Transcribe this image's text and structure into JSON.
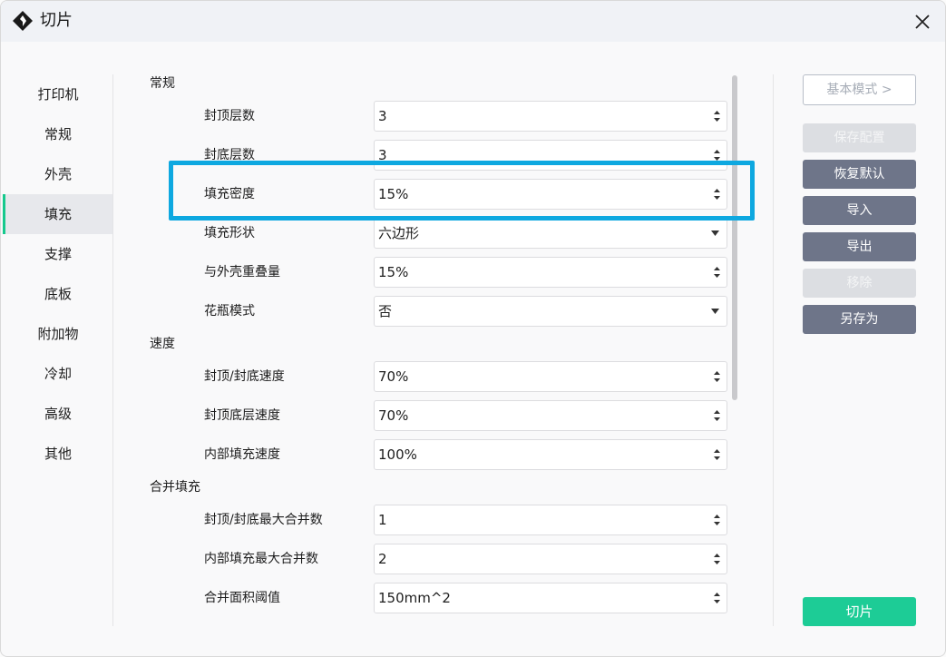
{
  "window": {
    "title": "切片"
  },
  "sidebar": {
    "items": [
      {
        "label": "打印机"
      },
      {
        "label": "常规"
      },
      {
        "label": "外壳"
      },
      {
        "label": "填充"
      },
      {
        "label": "支撑"
      },
      {
        "label": "底板"
      },
      {
        "label": "附加物"
      },
      {
        "label": "冷却"
      },
      {
        "label": "高级"
      },
      {
        "label": "其他"
      }
    ],
    "active_index": 3
  },
  "sections": {
    "general": {
      "title": "常规",
      "fields": [
        {
          "label": "封顶层数",
          "value": "3",
          "control": "spinbox"
        },
        {
          "label": "封底层数",
          "value": "3",
          "control": "spinbox"
        },
        {
          "label": "填充密度",
          "value": "15%",
          "control": "spinbox",
          "highlighted": true
        },
        {
          "label": "填充形状",
          "value": "六边形",
          "control": "dropdown"
        },
        {
          "label": "与外壳重叠量",
          "value": "15%",
          "control": "spinbox"
        },
        {
          "label": "花瓶模式",
          "value": "否",
          "control": "dropdown"
        }
      ]
    },
    "speed": {
      "title": "速度",
      "fields": [
        {
          "label": "封顶/封底速度",
          "value": "70%",
          "control": "spinbox"
        },
        {
          "label": "封顶底层速度",
          "value": "70%",
          "control": "spinbox"
        },
        {
          "label": "内部填充速度",
          "value": "100%",
          "control": "spinbox"
        }
      ]
    },
    "merge": {
      "title": "合并填充",
      "fields": [
        {
          "label": "封顶/封底最大合并数",
          "value": "1",
          "control": "spinbox"
        },
        {
          "label": "内部填充最大合并数",
          "value": "2",
          "control": "spinbox"
        },
        {
          "label": "合并面积阈值",
          "value": "150mm^2",
          "control": "spinbox"
        }
      ]
    }
  },
  "actions": {
    "mode_button": "基本模式 >",
    "save_config": "保存配置",
    "restore_default": "恢复默认",
    "import": "导入",
    "export": "导出",
    "remove": "移除",
    "save_as": "另存为",
    "slice": "切片"
  },
  "colors": {
    "accent": "#1dcc96",
    "highlight_border": "#0ea8e0",
    "button_enabled": "#6e7589",
    "button_disabled": "#dcdee2"
  }
}
